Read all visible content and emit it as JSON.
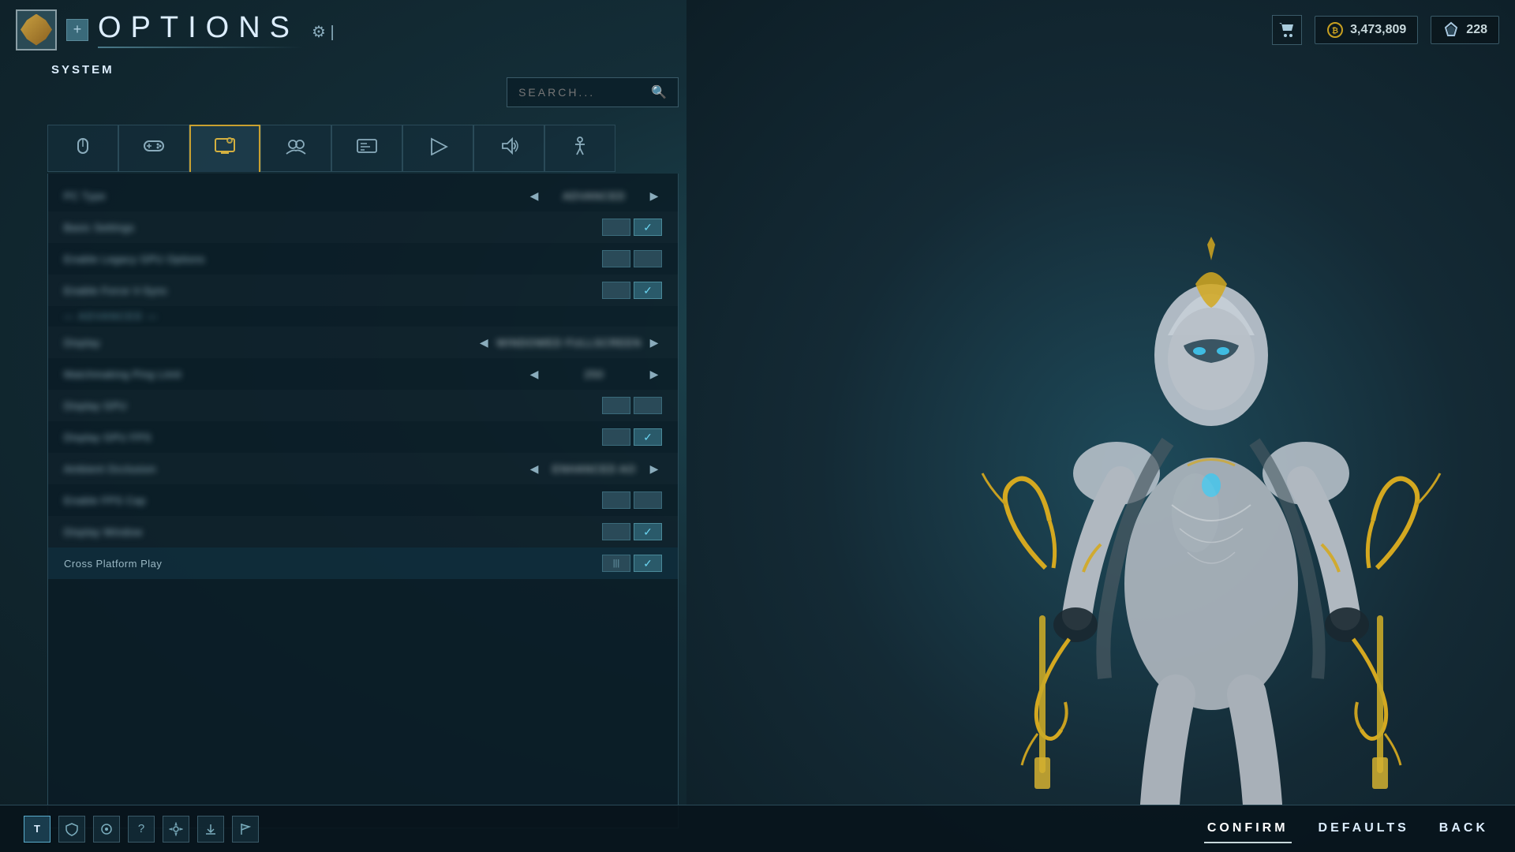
{
  "title": "OPTIONS",
  "section": "SYSTEM",
  "search_placeholder": "SEARCH...",
  "tabs": [
    {
      "id": "mouse",
      "icon": "🖱",
      "label": "Mouse/KB",
      "active": false
    },
    {
      "id": "controller",
      "icon": "🎮",
      "label": "Controller",
      "active": false
    },
    {
      "id": "display",
      "icon": "🖥",
      "label": "Display",
      "active": true
    },
    {
      "id": "social",
      "icon": "👥",
      "label": "Social",
      "active": false
    },
    {
      "id": "interface",
      "icon": "📋",
      "label": "Interface",
      "active": false
    },
    {
      "id": "gameplay",
      "icon": "▶",
      "label": "Gameplay",
      "active": false
    },
    {
      "id": "audio",
      "icon": "🔊",
      "label": "Audio",
      "active": false
    },
    {
      "id": "accessibility",
      "icon": "♿",
      "label": "Accessibility",
      "active": false
    }
  ],
  "settings": [
    {
      "id": "pc-type",
      "label": "PC Type",
      "type": "select",
      "value": "ADVANCED",
      "blurred": true
    },
    {
      "id": "item2",
      "label": "Basic Setting 1",
      "type": "toggle",
      "value": true,
      "blurred": true
    },
    {
      "id": "item3",
      "label": "Enable Legacy GPU Options",
      "type": "toggle",
      "value": false,
      "blurred": true
    },
    {
      "id": "item4",
      "label": "Enable Force V-Sync",
      "type": "toggle",
      "value": true,
      "blurred": true
    },
    {
      "id": "divider1",
      "label": "— ADVANCED —",
      "type": "divider",
      "blurred": true
    },
    {
      "id": "item5",
      "label": "Display",
      "type": "select",
      "value": "WINDOWED FULLSCREEN",
      "blurred": true
    },
    {
      "id": "item6",
      "label": "Matchmaking Ping Limit",
      "type": "select",
      "value": "250",
      "blurred": true
    },
    {
      "id": "item7",
      "label": "Display GPU",
      "type": "toggle",
      "value": false,
      "blurred": true
    },
    {
      "id": "item8",
      "label": "Display GPU FPS",
      "type": "toggle",
      "value": true,
      "blurred": true
    },
    {
      "id": "item9",
      "label": "Ambient Occlusion",
      "type": "select",
      "value": "ENHANCED AO",
      "blurred": true
    },
    {
      "id": "item10",
      "label": "Enable FPS Cap",
      "type": "toggle",
      "value": false,
      "blurred": true
    },
    {
      "id": "item11",
      "label": "Display Window",
      "type": "toggle",
      "value": true,
      "blurred": true
    },
    {
      "id": "cross-platform-play",
      "label": "Cross Platform Play",
      "type": "toggle",
      "value": true,
      "blurred": false
    }
  ],
  "currency": {
    "credits": "3,473,809",
    "platinum": "228"
  },
  "bottom_icons": [
    {
      "id": "warframe",
      "icon": "T",
      "active": true
    },
    {
      "id": "shield",
      "icon": "🛡",
      "active": false
    },
    {
      "id": "waypoint",
      "icon": "◎",
      "active": false
    },
    {
      "id": "help",
      "icon": "?",
      "active": false
    },
    {
      "id": "settings2",
      "icon": "⚙",
      "active": false
    },
    {
      "id": "download",
      "icon": "⬇",
      "active": false
    },
    {
      "id": "flag",
      "icon": "⚑",
      "active": false
    }
  ],
  "actions": {
    "confirm": "CONFIRM",
    "defaults": "DEFAULTS",
    "back": "BACK"
  }
}
